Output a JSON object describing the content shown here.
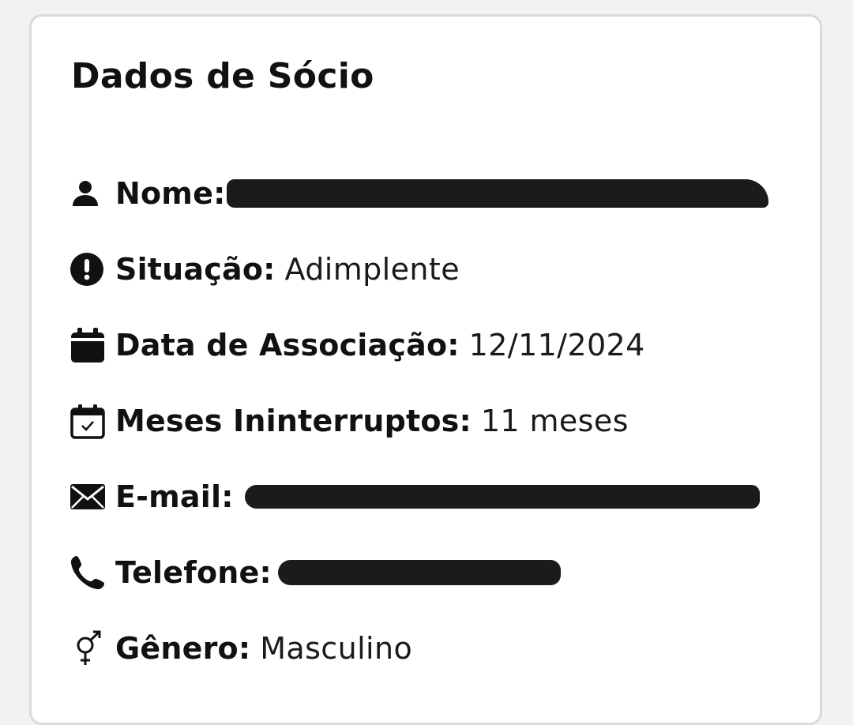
{
  "card": {
    "title": "Dados de Sócio"
  },
  "fields": {
    "nome": {
      "label": "Nome:",
      "icon": "user-icon"
    },
    "situacao": {
      "label": "Situação:",
      "value": "Adimplente",
      "icon": "alert-circle-icon"
    },
    "data_associacao": {
      "label": "Data de Associação:",
      "value": "12/11/2024",
      "icon": "calendar-icon"
    },
    "meses": {
      "label": "Meses Ininterruptos:",
      "value": "11 meses",
      "icon": "calendar-check-icon"
    },
    "email": {
      "label": "E-mail:",
      "icon": "envelope-icon"
    },
    "telefone": {
      "label": "Telefone:",
      "icon": "phone-icon"
    },
    "genero": {
      "label": "Gênero:",
      "value": "Masculino",
      "icon": "gender-icon"
    }
  },
  "colors": {
    "background": "#f2f2f2",
    "card": "#ffffff",
    "border": "#dadada",
    "text": "#111111",
    "redaction": "#1b1b1b"
  }
}
